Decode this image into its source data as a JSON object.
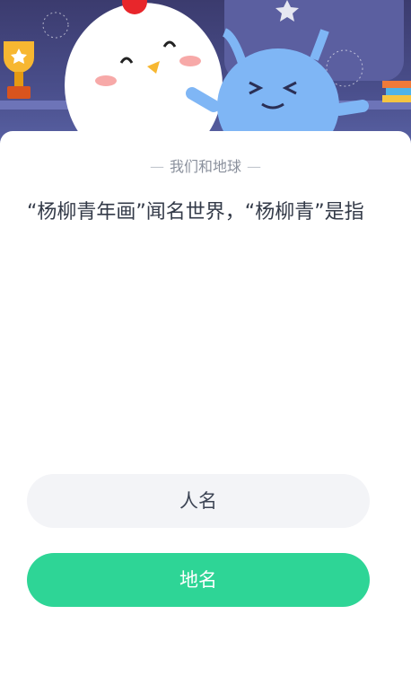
{
  "quiz": {
    "subject": "我们和地球",
    "question": "“杨柳青年画”闻名世界，“杨柳青”是指",
    "options": [
      {
        "label": "人名"
      },
      {
        "label": "地名"
      }
    ]
  },
  "colors": {
    "banner_bg": "#3b3b6e",
    "option_default_bg": "#f3f4f7",
    "option_selected_bg": "#2ed596",
    "question_text": "#333a48",
    "subject_text": "#8a909c"
  },
  "icons": [
    "trophy-icon",
    "chicken-mascot-icon",
    "blue-alien-mascot-icon",
    "books-icon",
    "star-icon"
  ]
}
